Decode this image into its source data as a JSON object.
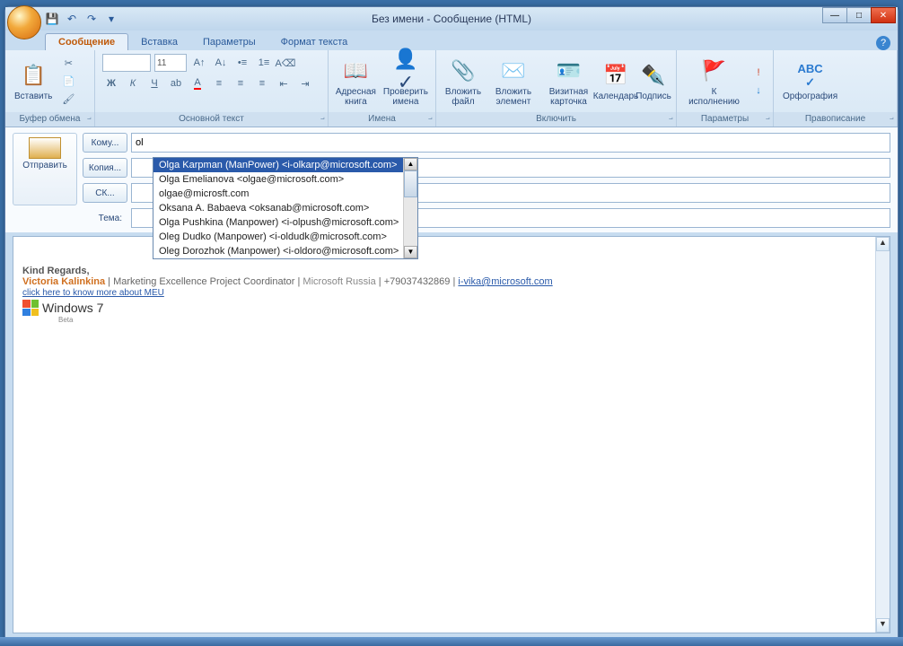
{
  "title": "Без имени - Сообщение (HTML)",
  "qat": {
    "save": "💾",
    "undo": "↶",
    "redo": "↷"
  },
  "tabs": {
    "message": "Сообщение",
    "insert": "Вставка",
    "options": "Параметры",
    "format": "Формат текста"
  },
  "ribbon": {
    "clipboard": {
      "paste": "Вставить",
      "label": "Буфер обмена"
    },
    "font": {
      "size": "11",
      "label": "Основной текст",
      "bold": "Ж",
      "italic": "К",
      "underline": "Ч"
    },
    "names": {
      "addressbook": "Адресная книга",
      "checknames": "Проверить имена",
      "label": "Имена"
    },
    "include": {
      "attachfile": "Вложить файл",
      "attachitem": "Вложить элемент",
      "bizcard": "Визитная карточка",
      "calendar": "Календарь",
      "signature": "Подпись",
      "label": "Включить"
    },
    "track": {
      "followup": "К исполнению",
      "label": "Параметры"
    },
    "spell": {
      "spelling": "Орфография",
      "label": "Правописание"
    }
  },
  "fields": {
    "send": "Отправить",
    "to": "Кому...",
    "cc": "Копия...",
    "bcc": "СК...",
    "subject": "Тема:",
    "to_value": "ol"
  },
  "autocomplete": [
    "Olga Karpman (ManPower)  <i-olkarp@microsoft.com>",
    "Olga Emelianova  <olgae@microsoft.com>",
    "olgae@microsft.com",
    "Oksana A. Babaeva  <oksanab@microsoft.com>",
    "Olga Pushkina (Manpower)  <i-olpush@microsoft.com>",
    "Oleg Dudko (Manpower)  <i-oldudk@microsoft.com>",
    "Oleg Dorozhok (Manpower)  <i-oldoro@microsoft.com>"
  ],
  "signature": {
    "regards": "Kind Regards,",
    "name": "Victoria Kalinkina",
    "role": " | Marketing Excellence Project Coordinator | ",
    "company": "Microsoft Russia",
    "phone": " | +79037432869 | ",
    "email": "i-vika@microsoft.com",
    "link": "click here to know more about MEU",
    "win7": "Windows 7",
    "beta": "Beta"
  }
}
